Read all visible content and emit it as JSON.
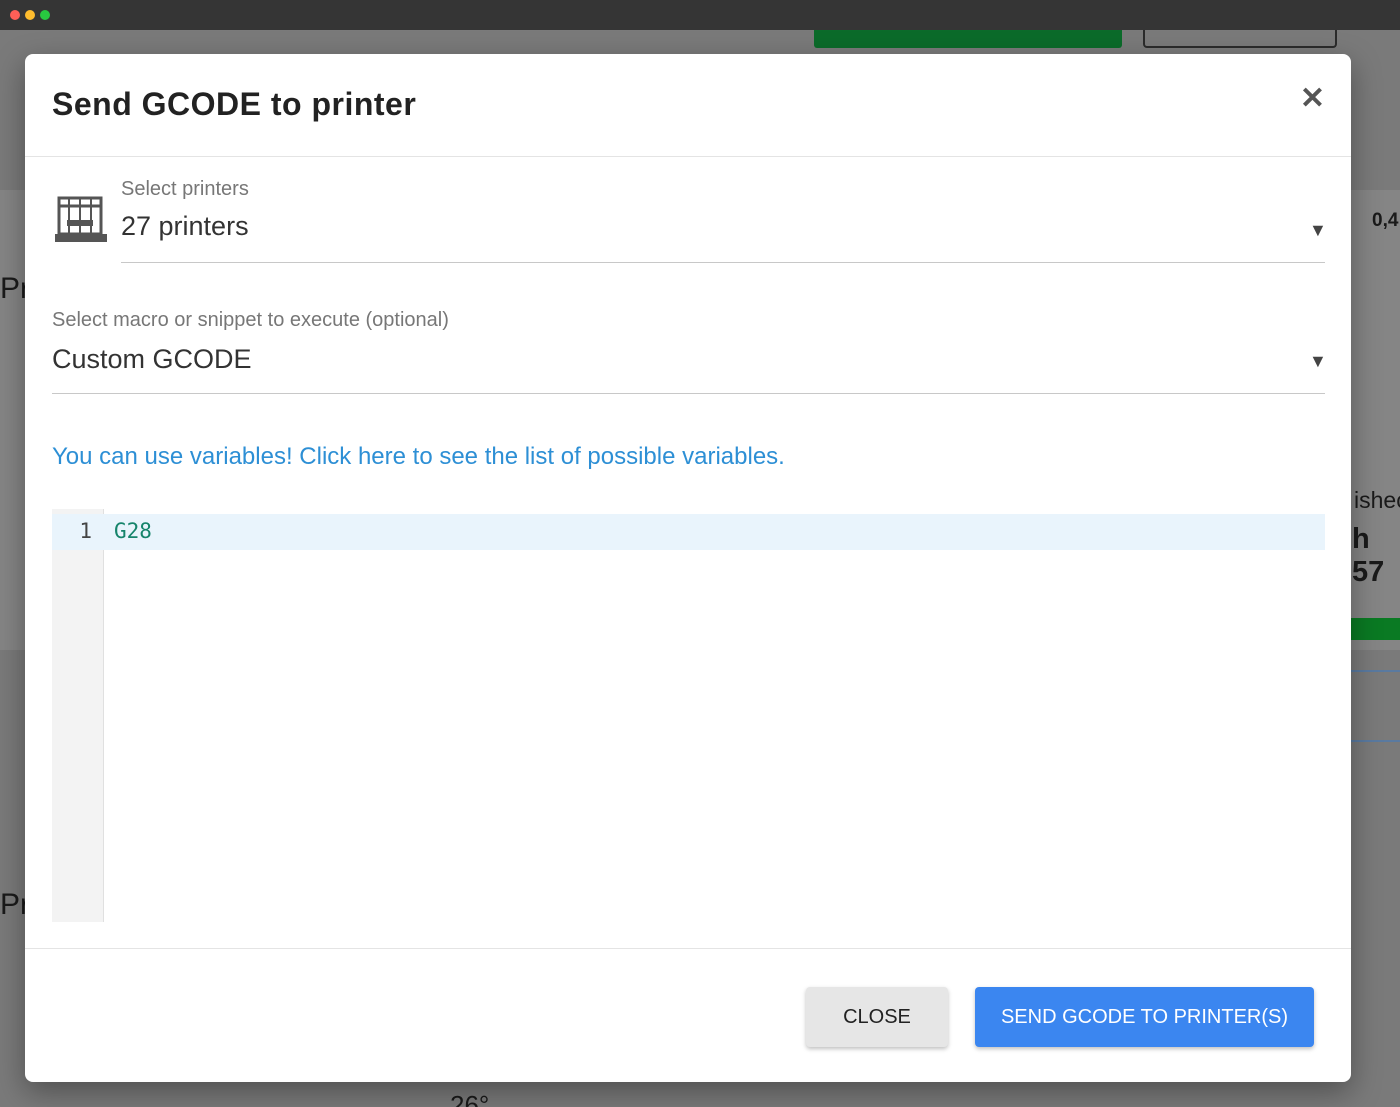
{
  "modal": {
    "title": "Send GCODE to printer",
    "close_glyph": "✕"
  },
  "printers_select": {
    "label": "Select printers",
    "value": "27 printers",
    "icon": "printer-icon"
  },
  "macro_select": {
    "label": "Select macro or snippet to execute (optional)",
    "value": "Custom GCODE"
  },
  "variables_link": "You can use variables! Click here to see the list of possible variables.",
  "editor": {
    "lines": [
      {
        "number": "1",
        "code": "G28"
      }
    ]
  },
  "footer": {
    "close_label": "CLOSE",
    "send_label": "SEND GCODE TO PRINTER(S)"
  },
  "background": {
    "fragments": [
      "0,4",
      "Pr",
      "ishec",
      "h 57",
      "Pr",
      "26°"
    ]
  },
  "colors": {
    "accent": "#3b86f0",
    "link": "#2d8fd5",
    "code": "#16846b"
  }
}
